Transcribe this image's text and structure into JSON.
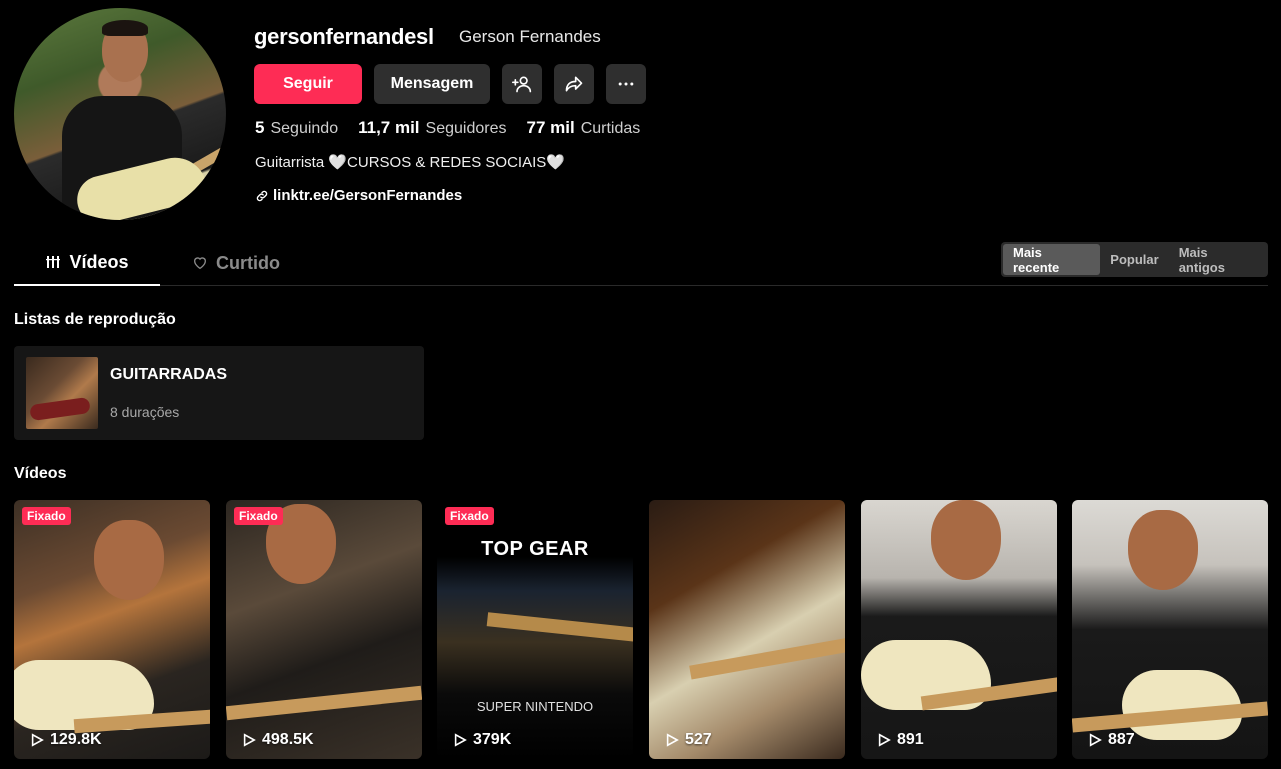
{
  "profile": {
    "username": "gersonfernandesl",
    "nickname": "Gerson Fernandes",
    "follow_label": "Seguir",
    "message_label": "Mensagem",
    "stats": [
      {
        "value": "5",
        "label": "Seguindo"
      },
      {
        "value": "11,7 mil",
        "label": "Seguidores"
      },
      {
        "value": "77 mil",
        "label": "Curtidas"
      }
    ],
    "bio": "Guitarrista 🤍CURSOS & REDES SOCIAIS🤍",
    "link": "linktr.ee/GersonFernandes"
  },
  "tabs": [
    {
      "label": "Vídeos",
      "icon": "grid-lines-icon",
      "active": true
    },
    {
      "label": "Curtido",
      "icon": "heart-lock-icon",
      "active": false
    }
  ],
  "sort_options": [
    {
      "label": "Mais recente",
      "active": true
    },
    {
      "label": "Popular",
      "active": false
    },
    {
      "label": "Mais antigos",
      "active": false
    }
  ],
  "playlists": {
    "title": "Listas de reprodução",
    "items": [
      {
        "name": "GUITARRADAS",
        "count": "8 durações"
      }
    ]
  },
  "videos": {
    "title": "Vídeos",
    "items": [
      {
        "views": "129.8K",
        "pinned": true,
        "badge": "Fixado"
      },
      {
        "views": "498.5K",
        "pinned": true,
        "badge": "Fixado"
      },
      {
        "views": "379K",
        "pinned": true,
        "badge": "Fixado",
        "overlay_title": "TOP GEAR",
        "overlay_sub": "SUPER NINTENDO"
      },
      {
        "views": "527",
        "pinned": false
      },
      {
        "views": "891",
        "pinned": false
      },
      {
        "views": "887",
        "pinned": false
      }
    ]
  },
  "colors": {
    "accent": "#fe2c55",
    "background": "#000000",
    "button_secondary": "#2f2f2f"
  }
}
